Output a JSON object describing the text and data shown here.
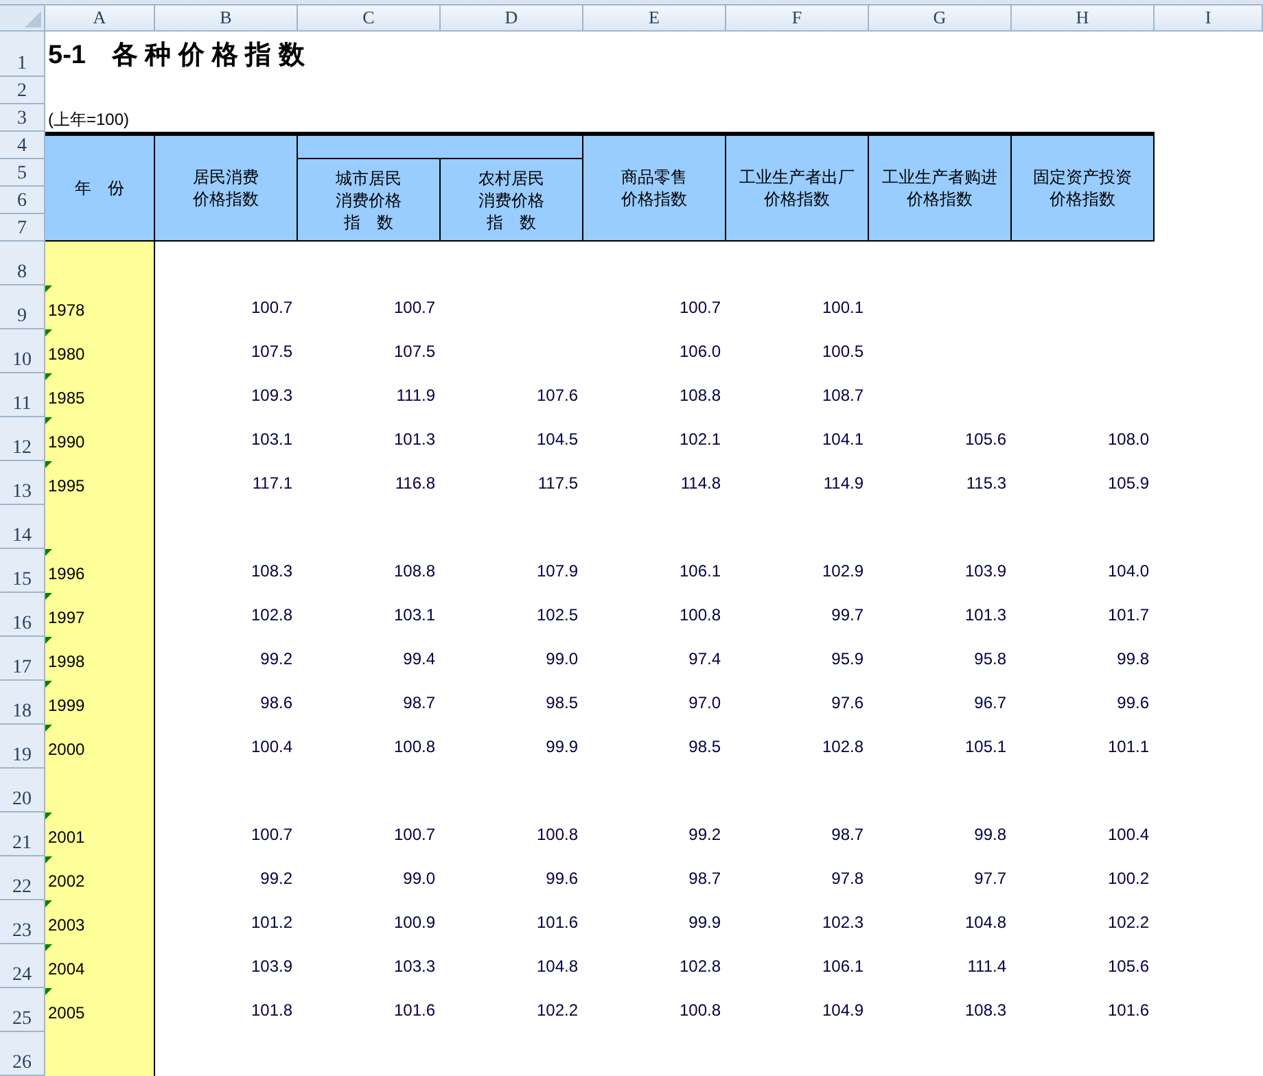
{
  "columns": [
    "A",
    "B",
    "C",
    "D",
    "E",
    "F",
    "G",
    "H",
    "I"
  ],
  "row_numbers": [
    "1",
    "2",
    "3",
    "4",
    "5",
    "6",
    "7",
    "8",
    "9",
    "10",
    "11",
    "12",
    "13",
    "14",
    "15",
    "16",
    "17",
    "18",
    "19",
    "20",
    "21",
    "22",
    "23",
    "24",
    "25",
    "26"
  ],
  "title": "5-1　各 种 价 格 指 数",
  "note": "(上年=100)",
  "headers": {
    "year": [
      "年　份"
    ],
    "cpi": [
      "居民消费",
      "价格指数"
    ],
    "urban": [
      "城市居民",
      "消费价格",
      "指　数"
    ],
    "rural": [
      "农村居民",
      "消费价格",
      "指　数"
    ],
    "retail": [
      "商品零售",
      "价格指数"
    ],
    "ppi_out": [
      "工业生产者出厂",
      "价格指数"
    ],
    "ppi_in": [
      "工业生产者购进",
      "价格指数"
    ],
    "fixed": [
      "固定资产投资",
      "价格指数"
    ]
  },
  "groups": [
    [
      {
        "year": "1978",
        "cells": {
          "B": "100.7",
          "C": "100.7",
          "E": "100.7",
          "F": "100.1"
        }
      },
      {
        "year": "1980",
        "cells": {
          "B": "107.5",
          "C": "107.5",
          "E": "106.0",
          "F": "100.5"
        }
      },
      {
        "year": "1985",
        "cells": {
          "B": "109.3",
          "C": "111.9",
          "D": "107.6",
          "E": "108.8",
          "F": "108.7"
        }
      },
      {
        "year": "1990",
        "cells": {
          "B": "103.1",
          "C": "101.3",
          "D": "104.5",
          "E": "102.1",
          "F": "104.1",
          "G": "105.6",
          "H": "108.0"
        }
      },
      {
        "year": "1995",
        "cells": {
          "B": "117.1",
          "C": "116.8",
          "D": "117.5",
          "E": "114.8",
          "F": "114.9",
          "G": "115.3",
          "H": "105.9"
        }
      }
    ],
    [
      {
        "year": "1996",
        "cells": {
          "B": "108.3",
          "C": "108.8",
          "D": "107.9",
          "E": "106.1",
          "F": "102.9",
          "G": "103.9",
          "H": "104.0"
        }
      },
      {
        "year": "1997",
        "cells": {
          "B": "102.8",
          "C": "103.1",
          "D": "102.5",
          "E": "100.8",
          "F": "99.7",
          "G": "101.3",
          "H": "101.7"
        }
      },
      {
        "year": "1998",
        "cells": {
          "B": "99.2",
          "C": "99.4",
          "D": "99.0",
          "E": "97.4",
          "F": "95.9",
          "G": "95.8",
          "H": "99.8"
        }
      },
      {
        "year": "1999",
        "cells": {
          "B": "98.6",
          "C": "98.7",
          "D": "98.5",
          "E": "97.0",
          "F": "97.6",
          "G": "96.7",
          "H": "99.6"
        }
      },
      {
        "year": "2000",
        "cells": {
          "B": "100.4",
          "C": "100.8",
          "D": "99.9",
          "E": "98.5",
          "F": "102.8",
          "G": "105.1",
          "H": "101.1"
        }
      }
    ],
    [
      {
        "year": "2001",
        "cells": {
          "B": "100.7",
          "C": "100.7",
          "D": "100.8",
          "E": "99.2",
          "F": "98.7",
          "G": "99.8",
          "H": "100.4"
        }
      },
      {
        "year": "2002",
        "cells": {
          "B": "99.2",
          "C": "99.0",
          "D": "99.6",
          "E": "98.7",
          "F": "97.8",
          "G": "97.7",
          "H": "100.2"
        }
      },
      {
        "year": "2003",
        "cells": {
          "B": "101.2",
          "C": "100.9",
          "D": "101.6",
          "E": "99.9",
          "F": "102.3",
          "G": "104.8",
          "H": "102.2"
        }
      },
      {
        "year": "2004",
        "cells": {
          "B": "103.9",
          "C": "103.3",
          "D": "104.8",
          "E": "102.8",
          "F": "106.1",
          "G": "111.4",
          "H": "105.6"
        }
      },
      {
        "year": "2005",
        "cells": {
          "B": "101.8",
          "C": "101.6",
          "D": "102.2",
          "E": "100.8",
          "F": "104.9",
          "G": "108.3",
          "H": "101.6"
        }
      }
    ]
  ]
}
